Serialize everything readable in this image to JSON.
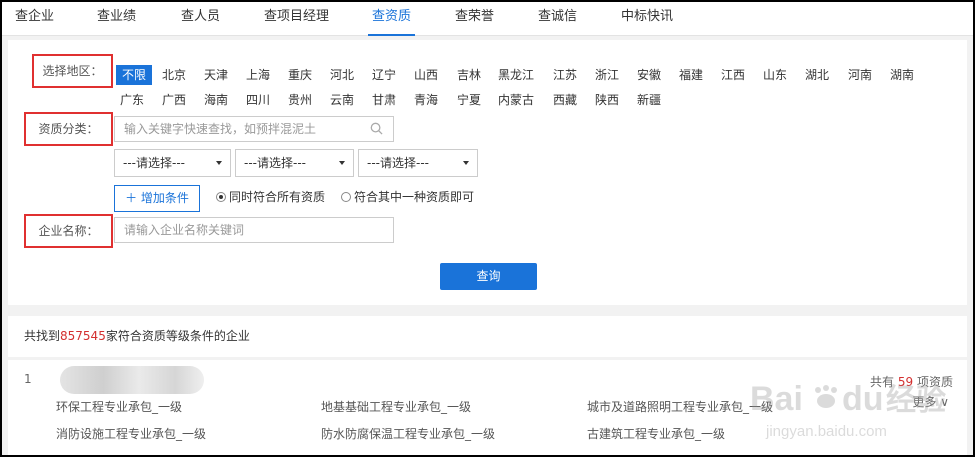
{
  "nav": {
    "tabs": [
      "查企业",
      "查业绩",
      "查人员",
      "查项目经理",
      "查资质",
      "查荣誉",
      "查诚信",
      "中标快讯"
    ],
    "active": "查资质"
  },
  "filters": {
    "region_label": "选择地区：",
    "regions_row1": [
      "不限",
      "北京",
      "天津",
      "上海",
      "重庆",
      "河北",
      "辽宁",
      "山西",
      "吉林",
      "黑龙江",
      "江苏",
      "浙江",
      "安徽",
      "福建",
      "江西",
      "山东",
      "湖北",
      "河南",
      "湖南"
    ],
    "regions_row2": [
      "广东",
      "广西",
      "海南",
      "四川",
      "贵州",
      "云南",
      "甘肃",
      "青海",
      "宁夏",
      "内蒙古",
      "西藏",
      "陕西",
      "新疆"
    ],
    "selected_region": "不限",
    "qualification_label": "资质分类：",
    "qualification_placeholder": "输入关键字快速查找，如预拌混泥土",
    "selects": [
      "---请选择---",
      "---请选择---",
      "---请选择---"
    ],
    "add_condition": "＋ 增加条件",
    "match_all": "同时符合所有资质",
    "match_any": "符合其中一种资质即可",
    "company_label": "企业名称：",
    "company_placeholder": "请输入企业名称关键词",
    "query_button": "查询"
  },
  "summary": {
    "prefix": "共找到",
    "count": "857545",
    "suffix": "家符合资质等级条件的企业"
  },
  "result": {
    "index": "1",
    "count_prefix": "共有",
    "count": "59",
    "count_suffix": "项资质",
    "more": "更多",
    "qualifications": [
      "环保工程专业承包_一级",
      "地基基础工程专业承包_一级",
      "城市及道路照明工程专业承包_一级",
      "消防设施工程专业承包_一级",
      "防水防腐保温工程专业承包_一级",
      "古建筑工程专业承包_一级"
    ]
  },
  "watermark": {
    "brand": "Bai",
    "brand2": "du",
    "cn": "经验",
    "url": "jingyan.baidu.com"
  },
  "colors": {
    "accent": "#1a73d9",
    "highlight": "#e03030",
    "count": "#d32f2f"
  }
}
